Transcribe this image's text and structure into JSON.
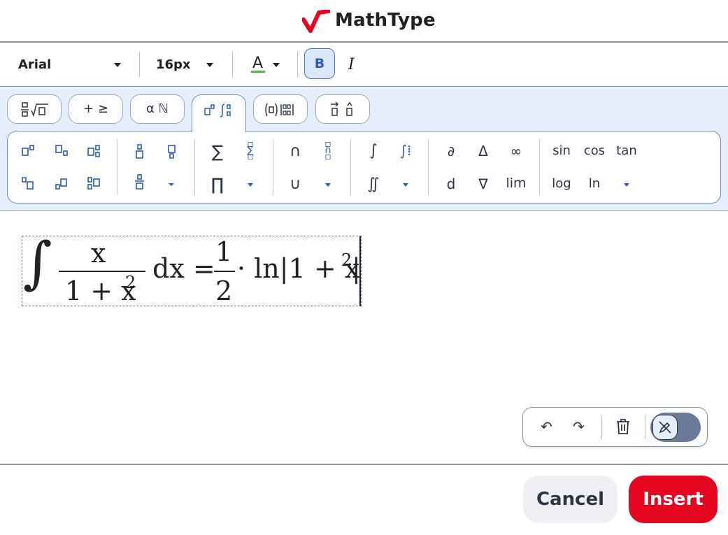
{
  "header": {
    "title": "MathType",
    "logo_icon": "mathtype-logo-icon"
  },
  "format_toolbar": {
    "font": "Arial",
    "size": "16px",
    "color_label": "A",
    "color_underline": "#3ec441",
    "bold": "B",
    "italic": "I"
  },
  "palette_tabs": [
    {
      "label": "⁼⁄₋√▫",
      "display": "fraction-radical"
    },
    {
      "label": "+ ≥"
    },
    {
      "label": "α ℕ"
    },
    {
      "label": "▫ ∫▫",
      "active": true
    },
    {
      "label": "(▫)⁞⁞"
    },
    {
      "label": "⃗▫ ̂▫"
    }
  ],
  "panel": {
    "greek_calc": [
      "∂",
      "Δ",
      "∞",
      "d",
      "∇",
      "lim"
    ],
    "functions": [
      "sin",
      "cos",
      "tan",
      "log",
      "ln"
    ],
    "ops": [
      "∑",
      "∏",
      "∩",
      "∪",
      "∫",
      "∬"
    ]
  },
  "formula": {
    "integral": "∫",
    "numerator": "x",
    "denominator_base": "1 + x",
    "exponent": "2",
    "dx": "dx =",
    "half_num": "1",
    "half_den": "2",
    "dot_ln": "· ln|1 + x",
    "closing": "|"
  },
  "floating_bar": {
    "undo": "↶",
    "redo": "↷",
    "delete": "🗑"
  },
  "footer": {
    "cancel": "Cancel",
    "insert": "Insert"
  },
  "colors": {
    "accent": "#2a5bb8",
    "insert": "#e3061e",
    "palette_bg": "#e6eefb"
  }
}
